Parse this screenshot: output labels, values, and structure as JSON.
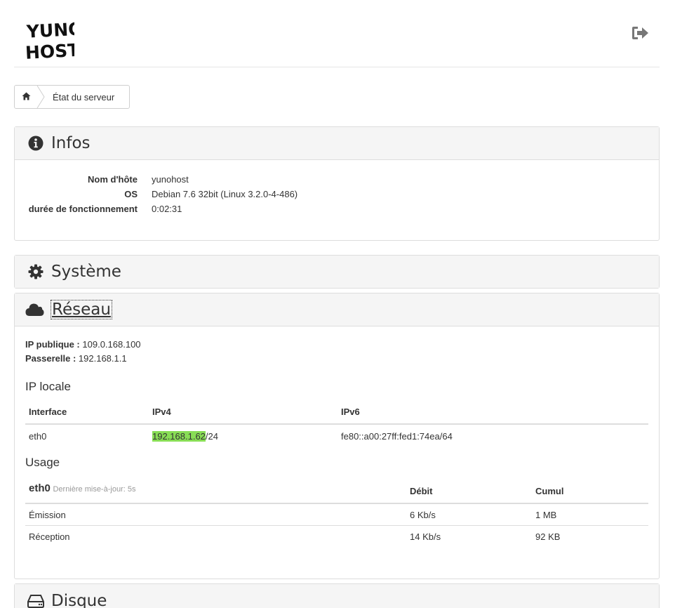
{
  "header": {
    "logo_line1": "YUNO",
    "logo_line2": "HOST",
    "logout_icon": "sign-out-icon"
  },
  "breadcrumb": {
    "home_icon": "home-icon",
    "current": "État du serveur"
  },
  "infos": {
    "title": "Infos",
    "icon": "info-circle-icon",
    "rows": [
      {
        "label": "Nom d'hôte",
        "value": "yunohost"
      },
      {
        "label": "OS",
        "value": "Debian 7.6 32bit (Linux 3.2.0-4-486)"
      },
      {
        "label": "durée de fonctionnement",
        "value": "0:02:31"
      }
    ]
  },
  "systeme": {
    "title": "Système",
    "icon": "gear-icon"
  },
  "reseau": {
    "title": "Réseau",
    "icon": "cloud-icon",
    "public_ip_label": "IP publique :",
    "public_ip": "109.0.168.100",
    "gateway_label": "Passerelle :",
    "gateway": "192.168.1.1",
    "local_ip_title": "IP locale",
    "local_ip_table": {
      "headers": [
        "Interface",
        "IPv4",
        "IPv6"
      ],
      "rows": [
        {
          "interface": "eth0",
          "ipv4_addr": "192.168.1.62",
          "ipv4_mask": "/24",
          "ipv6": "fe80::a00:27ff:fed1:74ea/64"
        }
      ]
    },
    "usage_title": "Usage",
    "usage_table": {
      "interface": "eth0",
      "updated": "Dernière mise-à-jour: 5s",
      "headers": [
        "Débit",
        "Cumul"
      ],
      "rows": [
        {
          "label": "Émission",
          "rate": "6 Kb/s",
          "total": "1 MB"
        },
        {
          "label": "Réception",
          "rate": "14 Kb/s",
          "total": "92 KB"
        }
      ]
    }
  },
  "disque": {
    "title": "Disque",
    "icon": "hdd-icon"
  },
  "colors": {
    "ip_highlight": "#88dd55",
    "panel_heading_bg": "#f5f5f5",
    "border": "#dddddd"
  }
}
